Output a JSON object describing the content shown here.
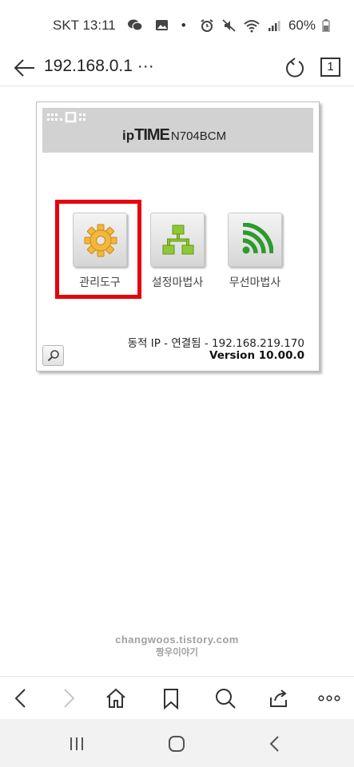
{
  "status_bar": {
    "carrier_time": "SKT 13:11",
    "dot": "•",
    "battery": "60%"
  },
  "url_bar": {
    "url": "192.168.0.1 ···",
    "tab_count": "1"
  },
  "router": {
    "brand_ip": "ip",
    "brand_time": "TIME",
    "brand_model": "N704BCM",
    "tiles": [
      {
        "label": "관리도구",
        "icon": "gear-icon"
      },
      {
        "label": "설정마법사",
        "icon": "network-icon"
      },
      {
        "label": "무선마법사",
        "icon": "wifi-icon"
      }
    ],
    "connection_status": "동적 IP - 연결됨 - 192.168.219.170",
    "version": "Version 10.00.0"
  },
  "watermark": {
    "site": "changwoos.tistory.com",
    "name": "짱우이야기"
  },
  "colors": {
    "highlight": "#e8000c",
    "gear": "#f4b73a",
    "network": "#8fc735",
    "wifi": "#2e9a2e"
  }
}
